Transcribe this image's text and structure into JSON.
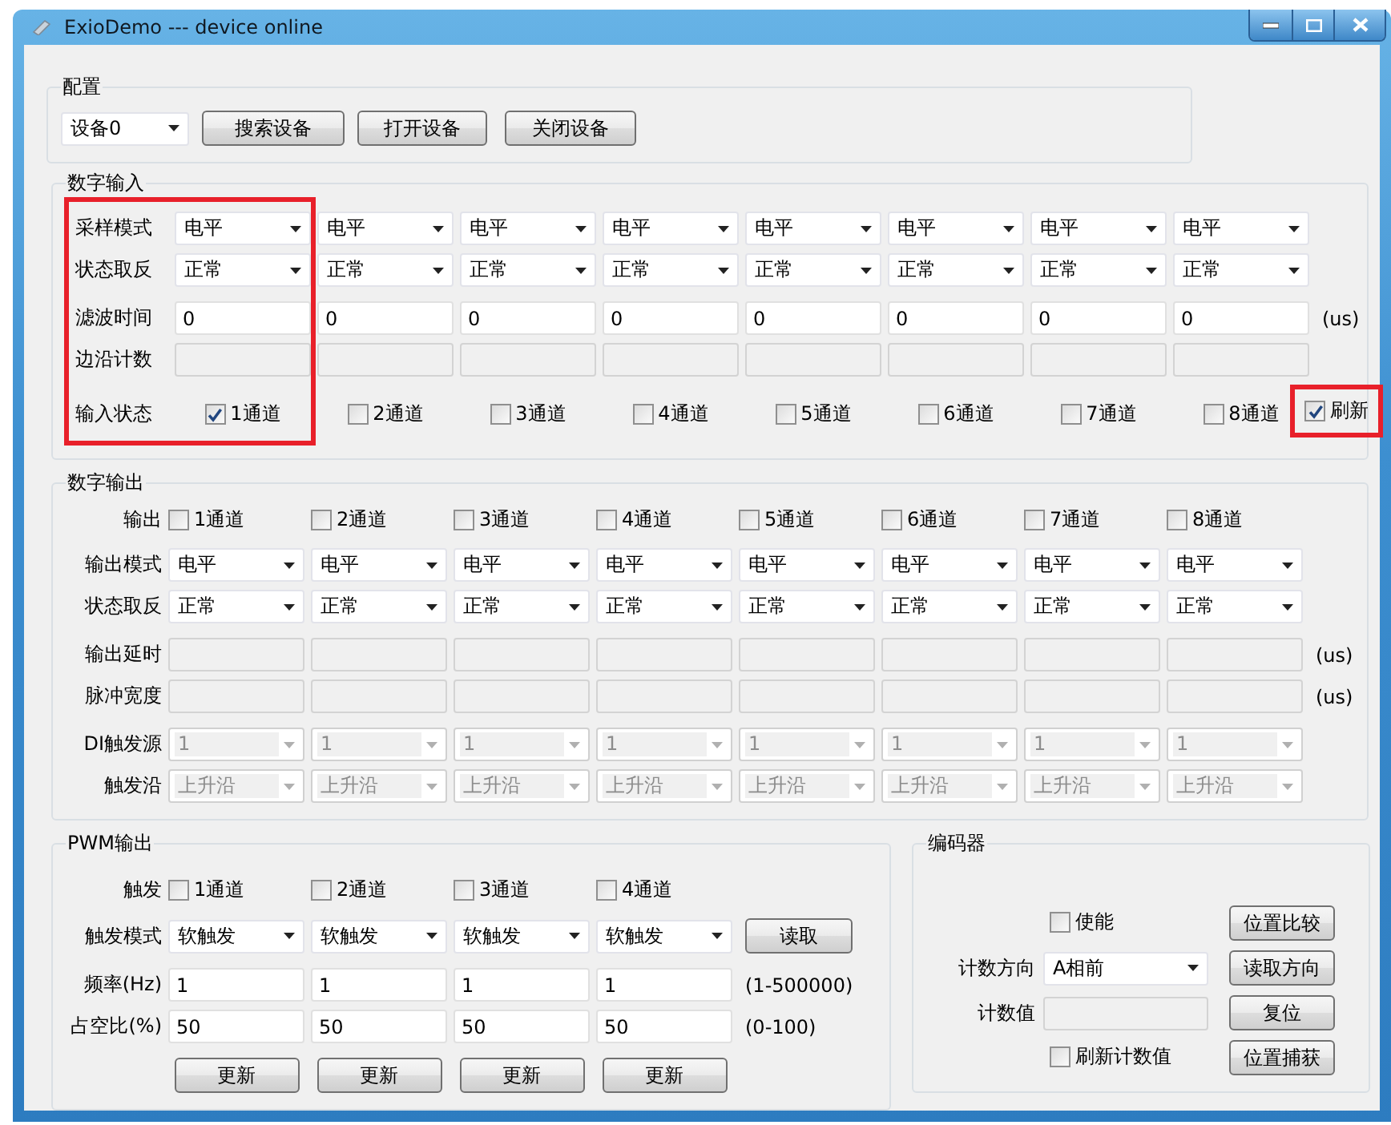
{
  "window": {
    "title": "ExioDemo --- device online"
  },
  "config": {
    "title": "配置",
    "device": "设备0",
    "buttons": [
      "搜索设备",
      "打开设备",
      "关闭设备"
    ]
  },
  "digital_input": {
    "title": "数字输入",
    "highlight_labels": true,
    "rows": [
      {
        "label": "采样模式",
        "kind": "select",
        "cells": [
          {
            "value": "电平",
            "disabled": false
          },
          {
            "value": "电平",
            "disabled": false
          },
          {
            "value": "电平",
            "disabled": false
          },
          {
            "value": "电平",
            "disabled": false
          },
          {
            "value": "电平",
            "disabled": false
          },
          {
            "value": "电平",
            "disabled": false
          },
          {
            "value": "电平",
            "disabled": false
          },
          {
            "value": "电平",
            "disabled": false
          }
        ]
      },
      {
        "label": "状态取反",
        "kind": "select",
        "cells": [
          {
            "value": "正常",
            "disabled": false
          },
          {
            "value": "正常",
            "disabled": false
          },
          {
            "value": "正常",
            "disabled": false
          },
          {
            "value": "正常",
            "disabled": false
          },
          {
            "value": "正常",
            "disabled": false
          },
          {
            "value": "正常",
            "disabled": false
          },
          {
            "value": "正常",
            "disabled": false
          },
          {
            "value": "正常",
            "disabled": false
          }
        ]
      },
      {
        "label": "滤波时间",
        "kind": "input",
        "unit": "(us)",
        "cells": [
          {
            "value": "0",
            "disabled": false
          },
          {
            "value": "0",
            "disabled": false
          },
          {
            "value": "0",
            "disabled": false
          },
          {
            "value": "0",
            "disabled": false
          },
          {
            "value": "0",
            "disabled": false
          },
          {
            "value": "0",
            "disabled": false
          },
          {
            "value": "0",
            "disabled": false
          },
          {
            "value": "0",
            "disabled": false
          }
        ]
      },
      {
        "label": "边沿计数",
        "kind": "input",
        "cells": [
          {
            "disabled": true
          },
          {
            "disabled": true
          },
          {
            "disabled": true
          },
          {
            "disabled": true
          },
          {
            "disabled": true
          },
          {
            "disabled": true
          },
          {
            "disabled": true
          },
          {
            "disabled": true
          }
        ]
      },
      {
        "label": "输入状态",
        "kind": "checkbox",
        "cells": [
          {
            "value": "1通道",
            "checked": true
          },
          {
            "value": "2通道",
            "checked": false
          },
          {
            "value": "3通道",
            "checked": false
          },
          {
            "value": "4通道",
            "checked": false
          },
          {
            "value": "5通道",
            "checked": false
          },
          {
            "value": "6通道",
            "checked": false
          },
          {
            "value": "7通道",
            "checked": false
          },
          {
            "value": "8通道",
            "checked": false
          }
        ]
      }
    ],
    "refresh": {
      "label": "刷新",
      "checked": true,
      "highlighted": true
    }
  },
  "digital_output": {
    "title": "数字输出",
    "rows": [
      {
        "label": "输出",
        "kind": "checkbox",
        "cells": [
          {
            "value": "1通道",
            "checked": false
          },
          {
            "value": "2通道",
            "checked": false
          },
          {
            "value": "3通道",
            "checked": false
          },
          {
            "value": "4通道",
            "checked": false
          },
          {
            "value": "5通道",
            "checked": false
          },
          {
            "value": "6通道",
            "checked": false
          },
          {
            "value": "7通道",
            "checked": false
          },
          {
            "value": "8通道",
            "checked": false
          }
        ]
      },
      {
        "label": "输出模式",
        "kind": "select",
        "cells": [
          {
            "value": "电平",
            "disabled": false
          },
          {
            "value": "电平",
            "disabled": false
          },
          {
            "value": "电平",
            "disabled": false
          },
          {
            "value": "电平",
            "disabled": false
          },
          {
            "value": "电平",
            "disabled": false
          },
          {
            "value": "电平",
            "disabled": false
          },
          {
            "value": "电平",
            "disabled": false
          },
          {
            "value": "电平",
            "disabled": false
          }
        ]
      },
      {
        "label": "状态取反",
        "kind": "select",
        "cells": [
          {
            "value": "正常",
            "disabled": false
          },
          {
            "value": "正常",
            "disabled": false
          },
          {
            "value": "正常",
            "disabled": false
          },
          {
            "value": "正常",
            "disabled": false
          },
          {
            "value": "正常",
            "disabled": false
          },
          {
            "value": "正常",
            "disabled": false
          },
          {
            "value": "正常",
            "disabled": false
          },
          {
            "value": "正常",
            "disabled": false
          }
        ]
      },
      {
        "label": "输出延时",
        "kind": "input",
        "unit": "(us)",
        "cells": [
          {
            "disabled": true
          },
          {
            "disabled": true
          },
          {
            "disabled": true
          },
          {
            "disabled": true
          },
          {
            "disabled": true
          },
          {
            "disabled": true
          },
          {
            "disabled": true
          },
          {
            "disabled": true
          }
        ]
      },
      {
        "label": "脉冲宽度",
        "kind": "input",
        "unit": "(us)",
        "cells": [
          {
            "disabled": true
          },
          {
            "disabled": true
          },
          {
            "disabled": true
          },
          {
            "disabled": true
          },
          {
            "disabled": true
          },
          {
            "disabled": true
          },
          {
            "disabled": true
          },
          {
            "disabled": true
          }
        ]
      },
      {
        "label": "DI触发源",
        "kind": "select",
        "cells": [
          {
            "value": "1",
            "disabled": true
          },
          {
            "value": "1",
            "disabled": true
          },
          {
            "value": "1",
            "disabled": true
          },
          {
            "value": "1",
            "disabled": true
          },
          {
            "value": "1",
            "disabled": true
          },
          {
            "value": "1",
            "disabled": true
          },
          {
            "value": "1",
            "disabled": true
          },
          {
            "value": "1",
            "disabled": true
          }
        ]
      },
      {
        "label": "触发沿",
        "kind": "select",
        "cells": [
          {
            "value": "上升沿",
            "disabled": true
          },
          {
            "value": "上升沿",
            "disabled": true
          },
          {
            "value": "上升沿",
            "disabled": true
          },
          {
            "value": "上升沿",
            "disabled": true
          },
          {
            "value": "上升沿",
            "disabled": true
          },
          {
            "value": "上升沿",
            "disabled": true
          },
          {
            "value": "上升沿",
            "disabled": true
          },
          {
            "value": "上升沿",
            "disabled": true
          }
        ]
      }
    ]
  },
  "pwm_output": {
    "title": "PWM输出",
    "rows": [
      {
        "label": "触发",
        "kind": "checkbox",
        "cells": [
          {
            "value": "1通道",
            "checked": false
          },
          {
            "value": "2通道",
            "checked": false
          },
          {
            "value": "3通道",
            "checked": false
          },
          {
            "value": "4通道",
            "checked": false
          }
        ]
      },
      {
        "label": "触发模式",
        "kind": "select",
        "action": "读取",
        "cells": [
          {
            "value": "软触发",
            "disabled": false
          },
          {
            "value": "软触发",
            "disabled": false
          },
          {
            "value": "软触发",
            "disabled": false
          },
          {
            "value": "软触发",
            "disabled": false
          }
        ]
      },
      {
        "label": "频率(Hz)",
        "kind": "input",
        "unit": "(1-500000)",
        "cells": [
          {
            "value": "1",
            "disabled": false
          },
          {
            "value": "1",
            "disabled": false
          },
          {
            "value": "1",
            "disabled": false
          },
          {
            "value": "1",
            "disabled": false
          }
        ]
      },
      {
        "label": "占空比(%)",
        "kind": "input",
        "unit": "(0-100)",
        "cells": [
          {
            "value": "50",
            "disabled": false
          },
          {
            "value": "50",
            "disabled": false
          },
          {
            "value": "50",
            "disabled": false
          },
          {
            "value": "50",
            "disabled": false
          }
        ]
      },
      {
        "kind": "button",
        "cells": [
          {
            "value": "更新"
          },
          {
            "value": "更新"
          },
          {
            "value": "更新"
          },
          {
            "value": "更新"
          }
        ]
      }
    ]
  },
  "encoder": {
    "title": "编码器",
    "enable": {
      "label": "使能",
      "checked": false
    },
    "direction": {
      "label": "计数方向",
      "value": "A相前"
    },
    "count": {
      "label": "计数值",
      "disabled": true
    },
    "refresh_count": {
      "label": "刷新计数值",
      "checked": false
    },
    "buttons": [
      "位置比较",
      "读取方向",
      "复位",
      "位置捕获"
    ]
  }
}
